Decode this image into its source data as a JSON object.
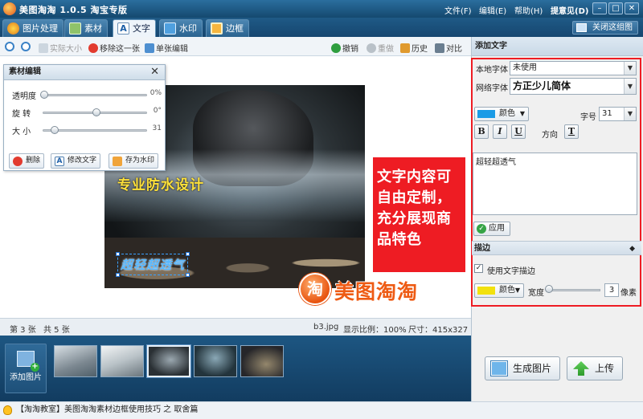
{
  "window": {
    "title": "美图淘淘 1.0.5 淘宝专版",
    "menus": [
      "文件(F)",
      "编辑(E)",
      "帮助(H)",
      "提意见(D)"
    ],
    "controls": [
      "–",
      "□",
      "✕"
    ]
  },
  "tabs": [
    "图片处理",
    "素材",
    "文字",
    "水印",
    "边框"
  ],
  "close_map": "关闭这组图",
  "toolbar": {
    "actual_size": "实际大小",
    "remove_one": "移除这一张",
    "single_edit": "单张编辑",
    "undo": "撤销",
    "redo": "重做",
    "history": "历史",
    "compare": "对比"
  },
  "material_panel": {
    "title": "素材编辑",
    "close": "✕",
    "sliders": [
      {
        "label": "透明度",
        "value": "0%",
        "fraction": 0.0
      },
      {
        "label": "旋 转",
        "value": "0°",
        "fraction": 0.5
      },
      {
        "label": "大 小",
        "value": "31",
        "fraction": 0.1
      }
    ],
    "buttons": [
      "删除",
      "修改文字",
      "存为水印"
    ]
  },
  "canvas": {
    "overlay_line1": "专业防水设计",
    "overlay_line2": "超轻超透气",
    "callout": "文字内容可自由定制，充分展现商品特色",
    "brand_glyph": "淘",
    "brand_text": "美图淘淘"
  },
  "status": {
    "current": "第 3 张",
    "total": "共 5 张",
    "filename": "b3.jpg",
    "ratio": "显示比例：100%",
    "size": "尺寸：415x327"
  },
  "filmstrip": {
    "add_label": "添加图片",
    "selected_index": 2
  },
  "right_panel": {
    "title": "添加文字",
    "local_font_label": "本地字体",
    "local_font_value": "未使用",
    "web_font_label": "网络字体",
    "web_font_value": "方正少儿简体",
    "color_label": "颜色",
    "text_color": "#1a9be6",
    "size_label": "字号",
    "size_value": "31",
    "bold": "B",
    "italic": "I",
    "underline": "U",
    "direction_label": "方向",
    "direction_glyph": "T",
    "text_content": "超轻超透气",
    "apply": "应用",
    "stroke_section": "描边",
    "use_stroke": "使用文字描边",
    "stroke_color_label": "颜色",
    "stroke_color": "#f2e10e",
    "width_label": "宽度",
    "width_value": "3",
    "unit": "像素"
  },
  "actions": {
    "generate": "生成图片",
    "upload": "上传"
  },
  "footer": "【淘淘教室】美图淘淘素材边框使用技巧 之 取舍篇"
}
